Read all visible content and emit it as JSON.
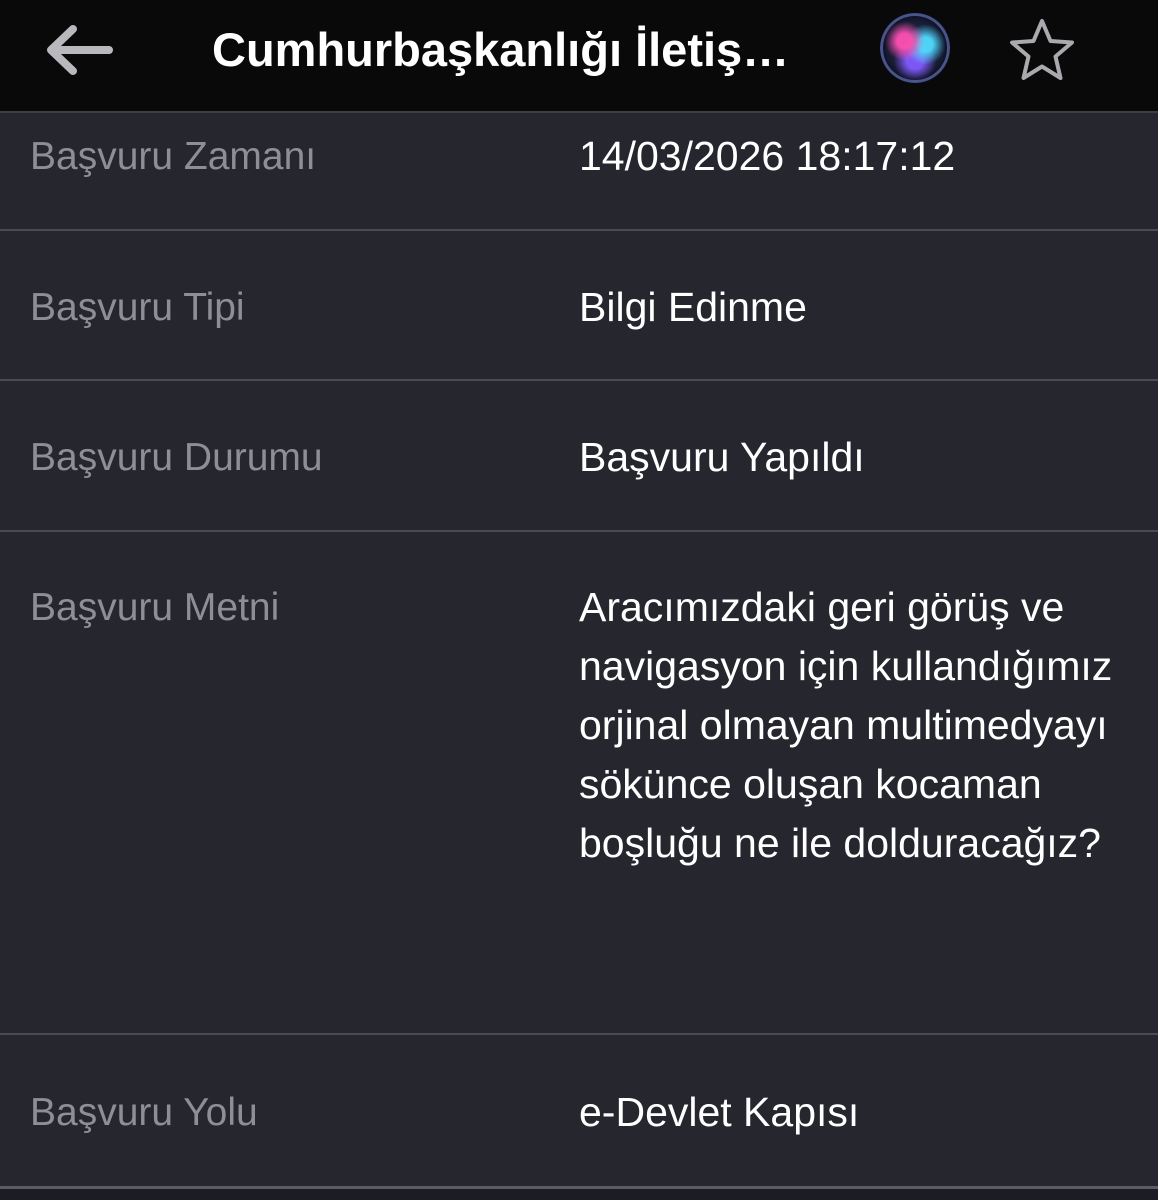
{
  "header": {
    "title": "Cumhurbaşkanlığı İletiş…",
    "back_icon": "arrow-left-icon",
    "siri_icon": "siri-icon",
    "favorite_icon": "star-outline-icon"
  },
  "details": [
    {
      "label": "Başvuru Zamanı",
      "value": "14/03/2026 18:17:12"
    },
    {
      "label": "Başvuru Tipi",
      "value": "Bilgi Edinme"
    },
    {
      "label": "Başvuru Durumu",
      "value": "Başvuru Yapıldı"
    },
    {
      "label": "Başvuru Metni",
      "value": "Aracımızdaki geri görüş ve navigasyon için kullandığımız orjinal olmayan multimedyayı sökünce oluşan kocaman boşluğu ne ile dolduracağız?"
    },
    {
      "label": "Başvuru Yolu",
      "value": "e-Devlet Kapısı"
    }
  ],
  "colors": {
    "header_background": "#090909",
    "page_background": "#25262e",
    "label_text": "#8e8f96",
    "value_text": "#ffffff",
    "divider": "#4a4b52"
  }
}
